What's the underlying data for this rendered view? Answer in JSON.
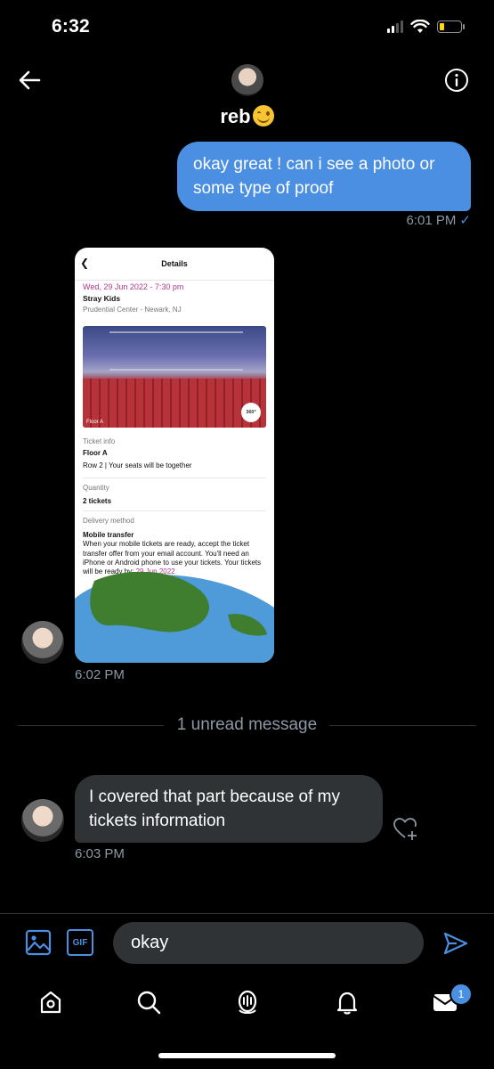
{
  "status_bar": {
    "time": "6:32"
  },
  "header": {
    "name": "reb",
    "back_icon": "arrow-left-icon",
    "info_icon": "info-icon"
  },
  "messages": {
    "outgoing_1": {
      "text": "okay great ! can i see a photo or some type of proof",
      "time": "6:01 PM",
      "read_mark": "✓"
    },
    "image_msg": {
      "time": "6:02 PM",
      "ticket": {
        "header": "Details",
        "date": "Wed, 29 Jun 2022 - 7:30 pm",
        "artist": "Stray Kids",
        "venue": "Prudential Center - Newark, NJ",
        "photo_label": "Floor A",
        "badge_360": "360°",
        "ticket_info_label": "Ticket info",
        "section": "Floor A",
        "seats": "Row 2 | Your seats will be together",
        "quantity_label": "Quantity",
        "quantity": "2 tickets",
        "delivery_label": "Delivery method",
        "delivery_method": "Mobile transfer",
        "delivery_text": "When your mobile tickets are ready, accept the ticket transfer offer from your email account. You'll need an iPhone or Android phone to use your tickets. Your tickets will be ready by:",
        "ready_date": "29 Jun 2022"
      }
    },
    "unread_divider": "1 unread message",
    "incoming_1": {
      "text": "I covered that part because of my tickets information",
      "time": "6:03 PM"
    }
  },
  "composer": {
    "value": "okay",
    "image_icon": "image-icon",
    "gif_label": "GIF",
    "send_icon": "send-icon"
  },
  "tabbar": {
    "messages_badge": "1"
  },
  "colors": {
    "accent": "#4a8fe2",
    "bubble_in": "#2f3336",
    "muted": "#8b98a5",
    "ticket_pink": "#b0378e"
  }
}
